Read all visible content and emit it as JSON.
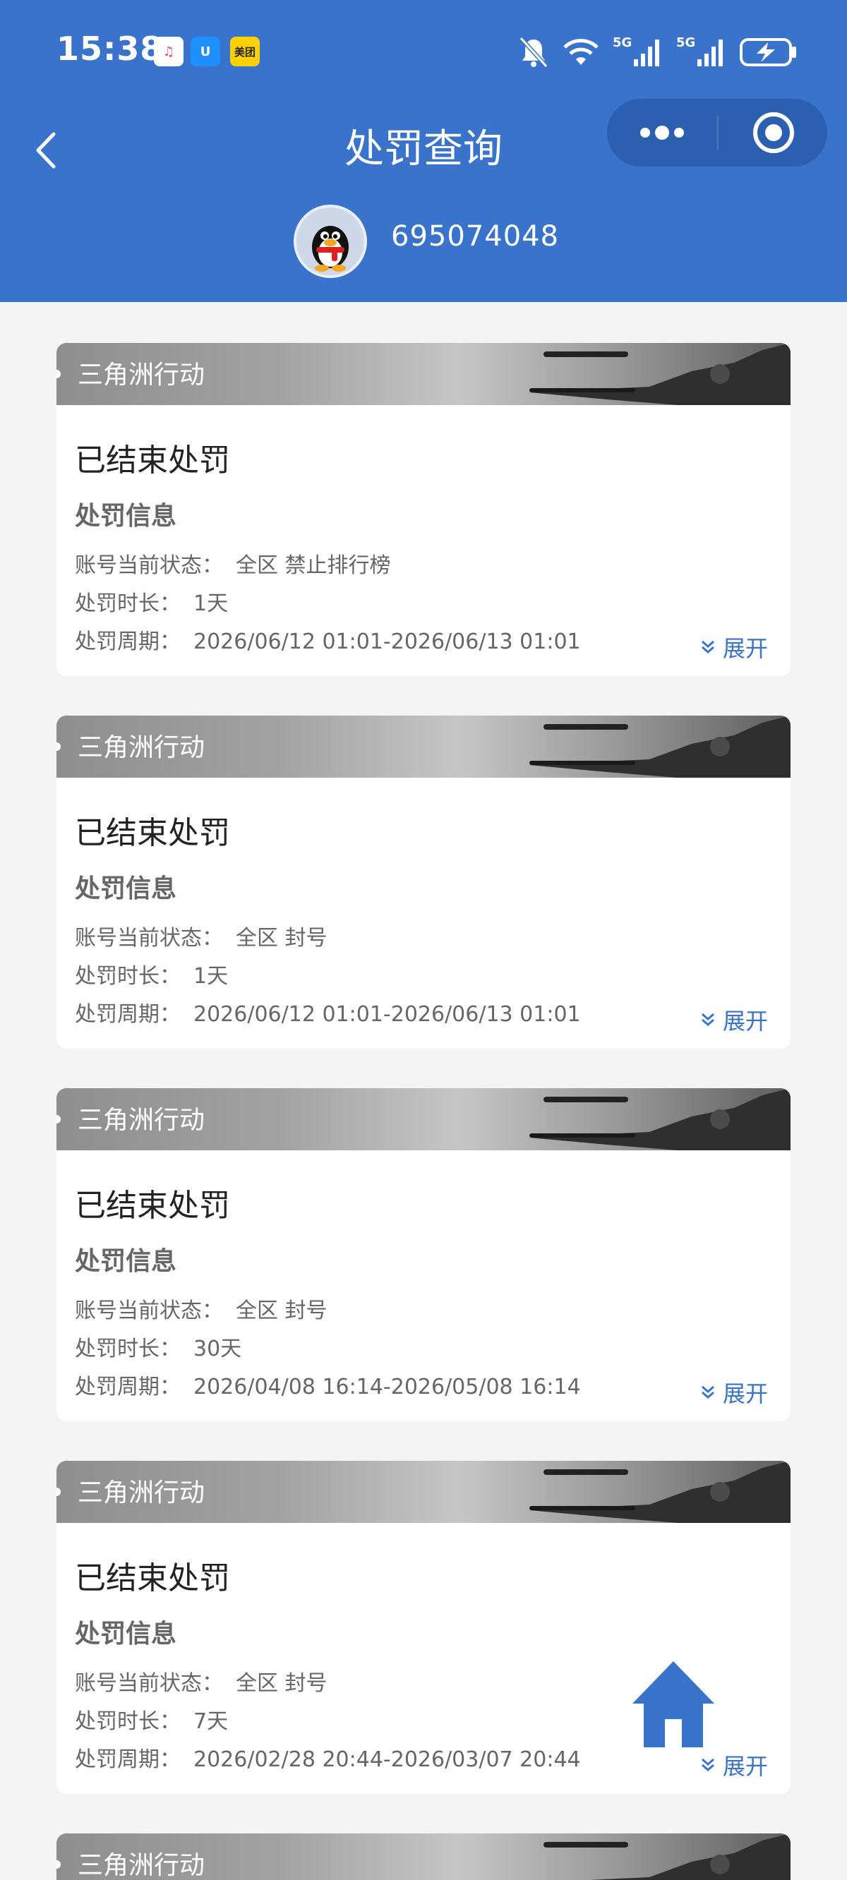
{
  "status_bar": {
    "time": "15:38",
    "apps": [
      {
        "name": "music-app-icon",
        "bg": "#ffffff",
        "fg": "#f2436a",
        "glyph": "♫"
      },
      {
        "name": "u-app-icon",
        "bg": "#1e90ff",
        "fg": "#ffffff",
        "glyph": "U"
      },
      {
        "name": "meituan-app-icon",
        "bg": "#ffd100",
        "fg": "#222222",
        "glyph": "美团"
      }
    ],
    "network1": "5G",
    "network2": "5G"
  },
  "nav": {
    "title": "处罚查询"
  },
  "user": {
    "id": "695074048"
  },
  "cards": [
    {
      "game": "三角洲行动",
      "status": "已结束处罚",
      "info_heading": "处罚信息",
      "state_label": "账号当前状态：",
      "state_value": "全区 禁止排行榜",
      "duration_label": "处罚时长：",
      "duration_value": "1天",
      "period_label": "处罚周期：",
      "period_value": "2026/06/12 01:01-2026/06/13 01:01",
      "expand": "展开"
    },
    {
      "game": "三角洲行动",
      "status": "已结束处罚",
      "info_heading": "处罚信息",
      "state_label": "账号当前状态：",
      "state_value": "全区 封号",
      "duration_label": "处罚时长：",
      "duration_value": "1天",
      "period_label": "处罚周期：",
      "period_value": "2026/06/12 01:01-2026/06/13 01:01",
      "expand": "展开"
    },
    {
      "game": "三角洲行动",
      "status": "已结束处罚",
      "info_heading": "处罚信息",
      "state_label": "账号当前状态：",
      "state_value": "全区 封号",
      "duration_label": "处罚时长：",
      "duration_value": "30天",
      "period_label": "处罚周期：",
      "period_value": "2026/04/08 16:14-2026/05/08 16:14",
      "expand": "展开"
    },
    {
      "game": "三角洲行动",
      "status": "已结束处罚",
      "info_heading": "处罚信息",
      "state_label": "账号当前状态：",
      "state_value": "全区 封号",
      "duration_label": "处罚时长：",
      "duration_value": "7天",
      "period_label": "处罚周期：",
      "period_value": "2026/02/28 20:44-2026/03/07 20:44",
      "expand": "展开"
    },
    {
      "game": "三角洲行动"
    }
  ],
  "colors": {
    "header": "#3a73cc",
    "accent": "#3a73cc"
  }
}
